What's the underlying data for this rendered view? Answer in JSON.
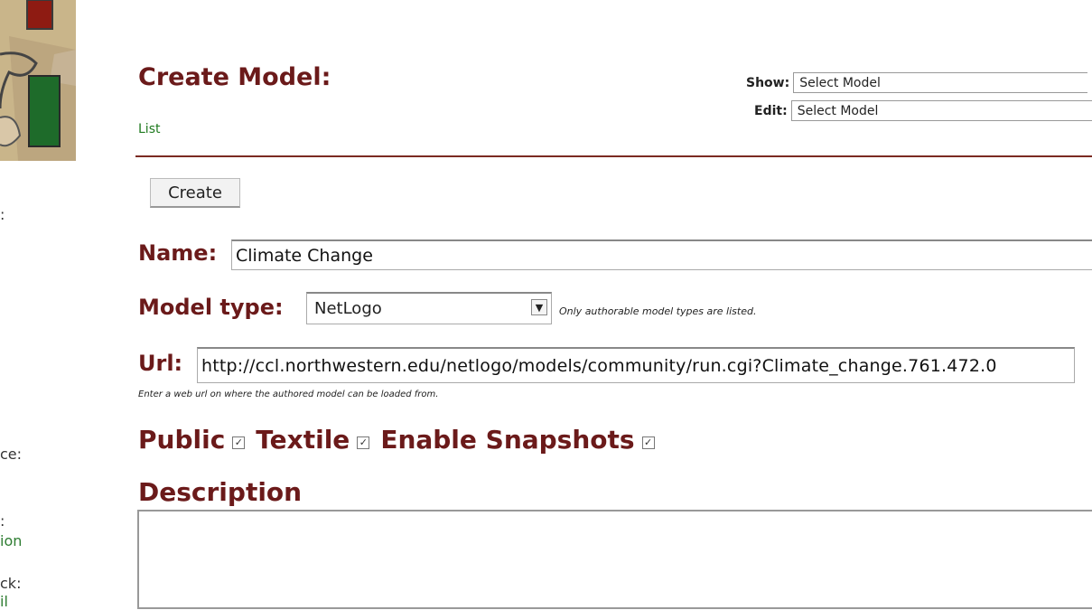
{
  "page": {
    "title": "Create Model:",
    "list_link": "List"
  },
  "nav": {
    "show_label": "Show:",
    "show_value": "Select Model",
    "edit_label": "Edit:",
    "edit_value": "Select Model"
  },
  "toolbar": {
    "create_label": "Create"
  },
  "form": {
    "name_label": "Name:",
    "name_value": "Climate Change",
    "model_type_label": "Model type:",
    "model_type_value": "NetLogo",
    "model_type_hint": "Only authorable model types are listed.",
    "url_label": "Url:",
    "url_value": "http://ccl.northwestern.edu/netlogo/models/community/run.cgi?Climate_change.761.472.0",
    "url_hint": "Enter a web url on where the authored model can be loaded from.",
    "public_label": "Public",
    "public_checked": true,
    "textile_label": "Textile",
    "textile_checked": true,
    "snapshots_label": "Enable Snapshots",
    "snapshots_checked": true,
    "description_label": "Description",
    "description_value": ""
  },
  "sidebar_fragments": [
    ":",
    "ce:",
    ":",
    "ion",
    "ck:",
    "il"
  ],
  "colors": {
    "heading": "#6b1a1a",
    "link": "#1f7a1f",
    "divider": "#7b2a22"
  }
}
